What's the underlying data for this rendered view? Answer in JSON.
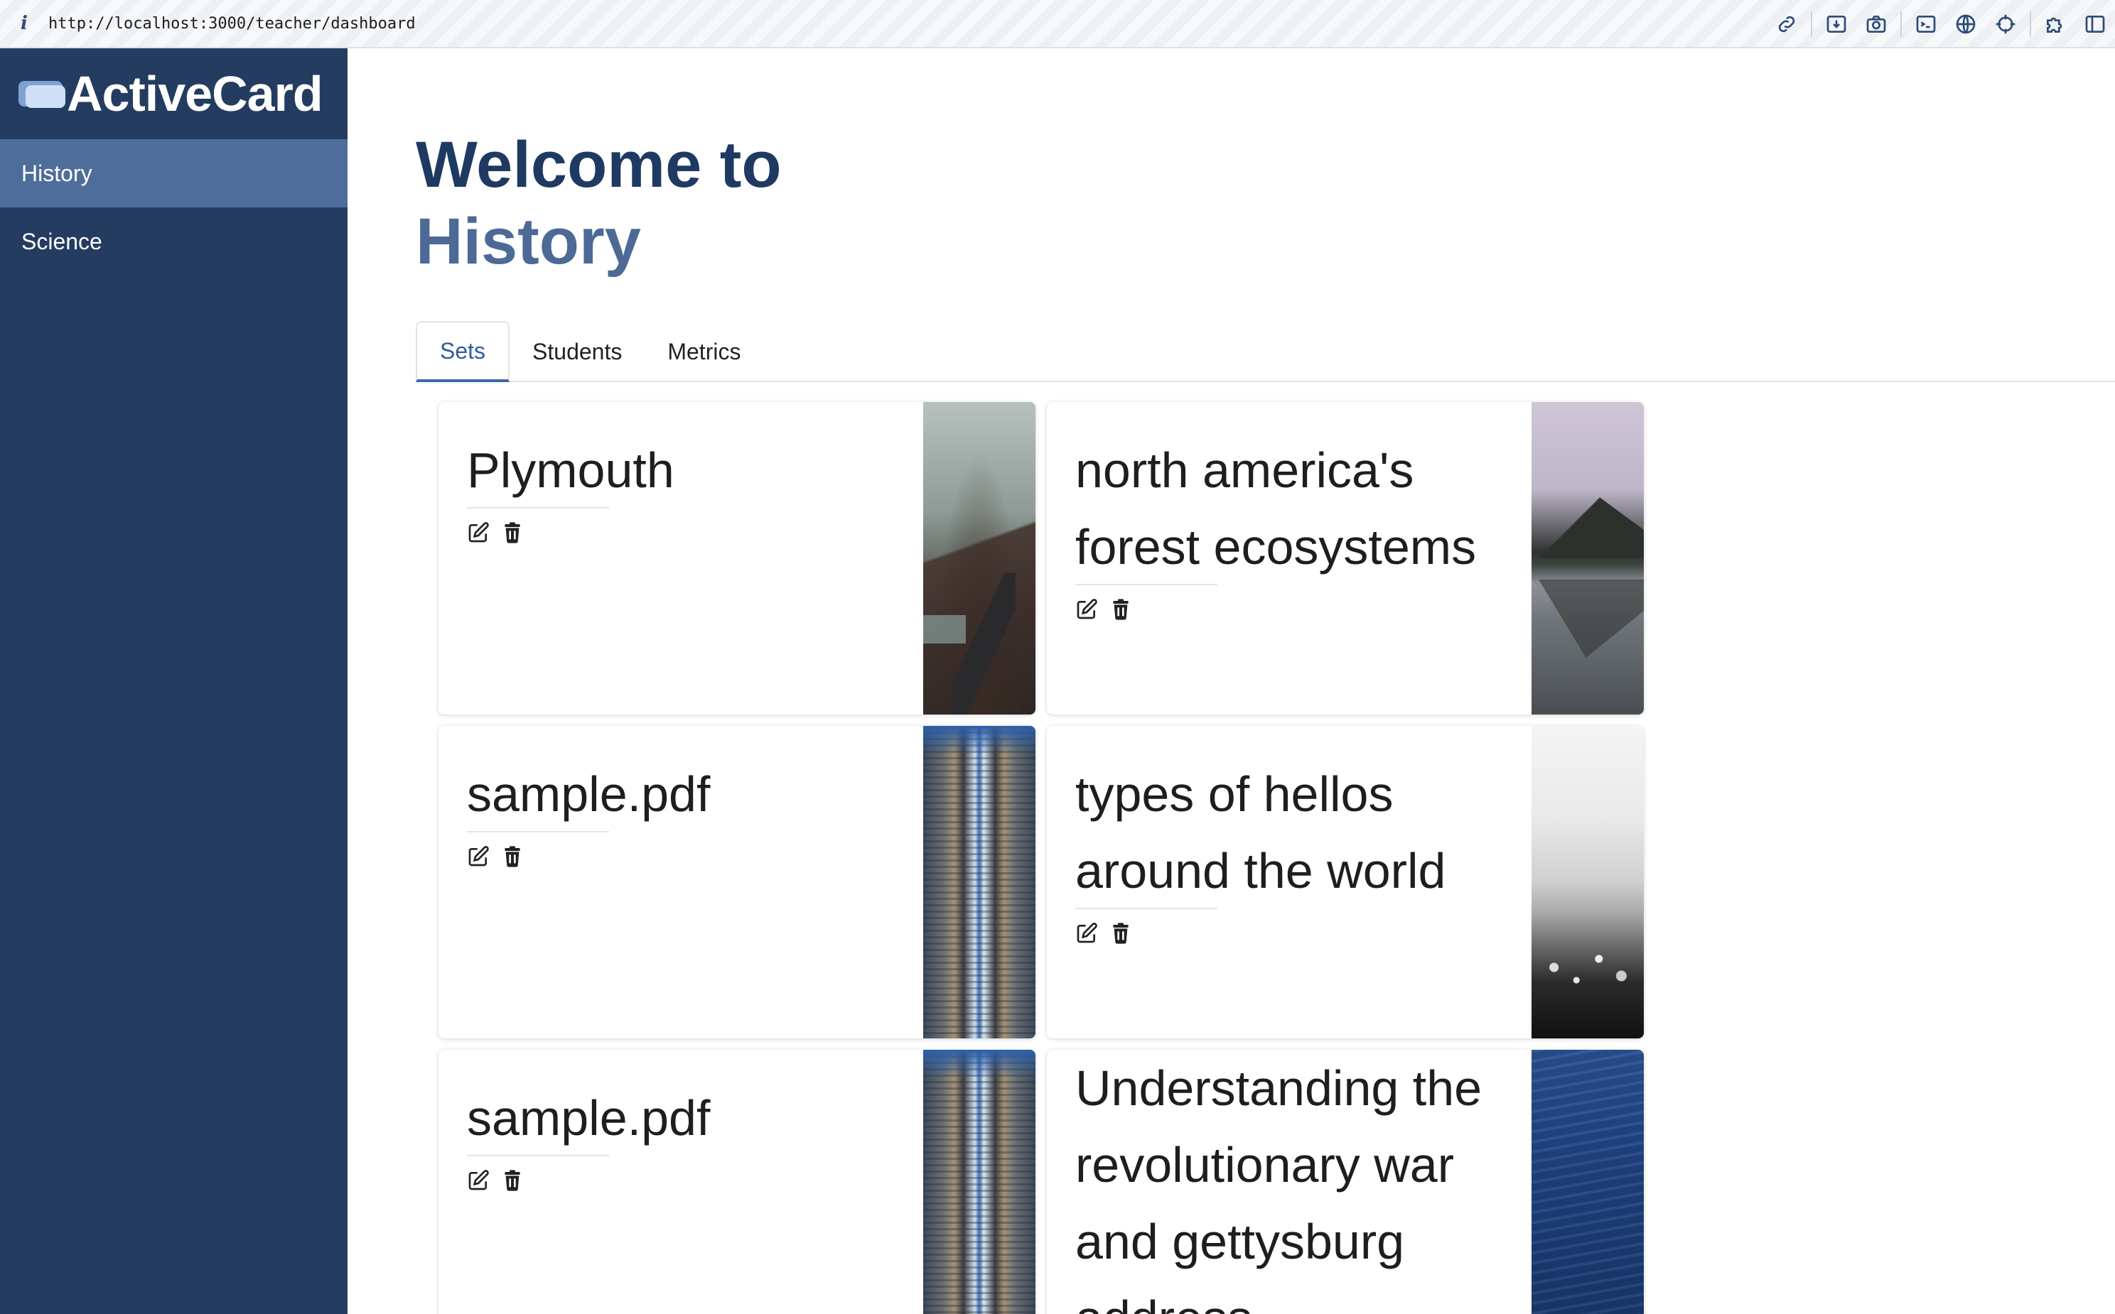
{
  "browser": {
    "url": "http://localhost:3000/teacher/dashboard",
    "info_glyph": "i",
    "tools": [
      "link-icon",
      "download-icon",
      "camera-icon",
      "terminal-icon",
      "globe-icon",
      "crosshair-icon",
      "puzzle-icon",
      "sidebar-icon"
    ]
  },
  "sidebar": {
    "brand": "ActiveCard",
    "items": [
      {
        "label": "History",
        "active": true
      },
      {
        "label": "Science",
        "active": false
      }
    ]
  },
  "main": {
    "welcome_line": "Welcome to",
    "subject": "History",
    "tabs": [
      {
        "label": "Sets",
        "active": true
      },
      {
        "label": "Students",
        "active": false
      },
      {
        "label": "Metrics",
        "active": false
      }
    ],
    "cards": [
      {
        "title": "Plymouth"
      },
      {
        "title": "north america's forest ecosystems"
      },
      {
        "title": "sample.pdf"
      },
      {
        "title": "types of hellos around the world"
      },
      {
        "title": "sample.pdf"
      },
      {
        "title": "Understanding the revolutionary war and gettysburg address"
      }
    ]
  },
  "colors": {
    "sidebar_bg": "#243c60",
    "sidebar_active": "#4e6d9a",
    "heading": "#1f3a62",
    "subject": "#4d6a96",
    "tab_active": "#3b6aa8"
  }
}
